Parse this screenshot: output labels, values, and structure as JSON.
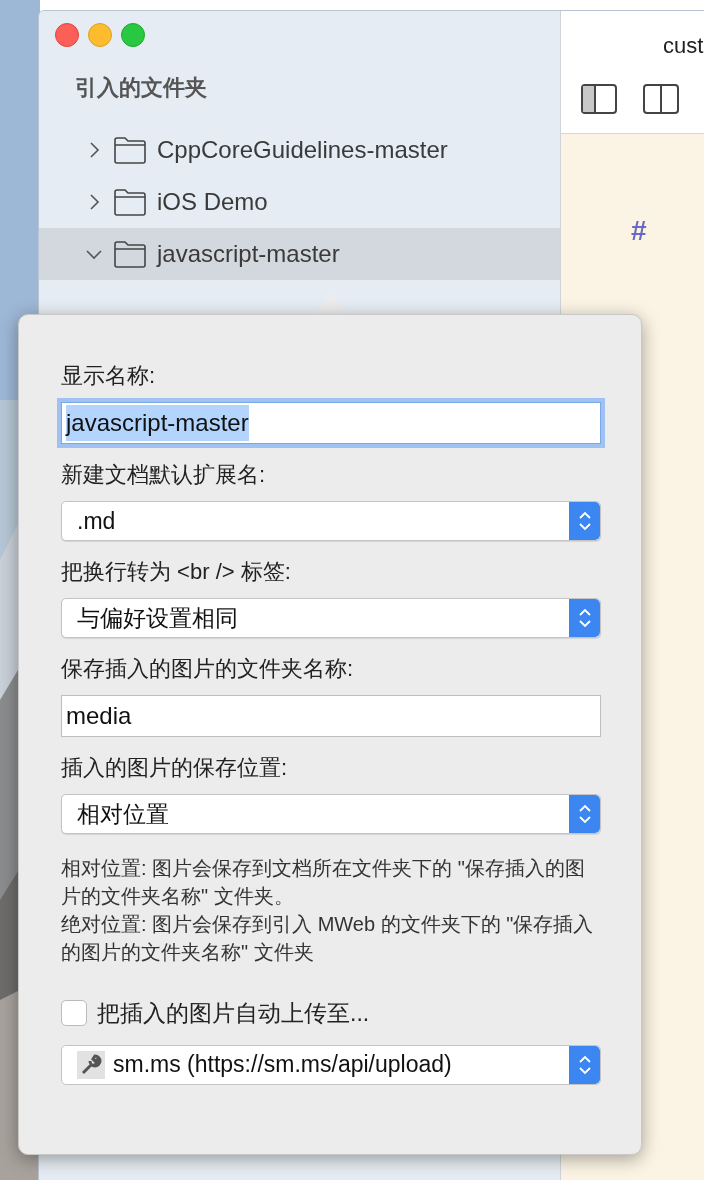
{
  "window": {
    "title": "cust"
  },
  "sidebar": {
    "title": "引入的文件夹",
    "items": [
      {
        "label": "CppCoreGuidelines-master",
        "expanded": false,
        "selected": false
      },
      {
        "label": "iOS Demo",
        "expanded": false,
        "selected": false
      },
      {
        "label": "javascript-master",
        "expanded": true,
        "selected": true
      }
    ]
  },
  "editor": {
    "heading_mark": "#"
  },
  "popover": {
    "fields": [
      {
        "kind": "text",
        "label": "显示名称:",
        "value": "javascript-master",
        "focused": true,
        "text_selected": true
      },
      {
        "kind": "select",
        "label": "新建文档默认扩展名:",
        "value": ".md"
      },
      {
        "kind": "select",
        "label": "把换行转为 <br /> 标签:",
        "value": "与偏好设置相同"
      },
      {
        "kind": "text",
        "label": "保存插入的图片的文件夹名称:",
        "value": "media",
        "focused": false,
        "text_selected": false
      },
      {
        "kind": "select",
        "label": "插入的图片的保存位置:",
        "value": "相对位置"
      }
    ],
    "help_text": [
      "相对位置: 图片会保存到文档所在文件夹下的 \"保存插入的图片的文件夹名称\" 文件夹。",
      "绝对位置: 图片会保存到引入 MWeb 的文件夹下的 \"保存插入的图片的文件夹名称\" 文件夹"
    ],
    "upload_checkbox": {
      "label": "把插入的图片自动上传至...",
      "checked": false
    },
    "upload_service": {
      "value": "sm.ms (https://sm.ms/api/upload)"
    }
  }
}
